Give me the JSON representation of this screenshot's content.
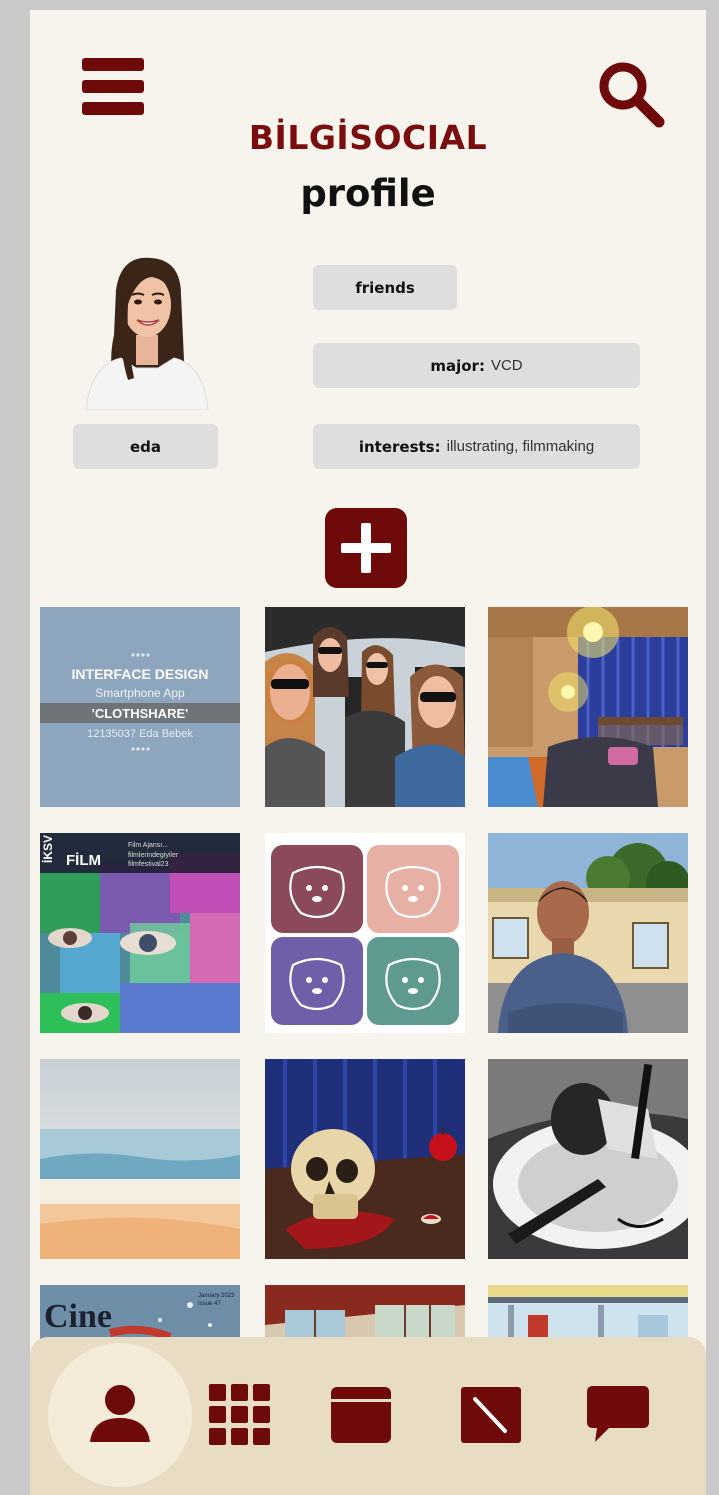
{
  "app": {
    "brand": "BİLGİSOCIAL",
    "page_title": "profile"
  },
  "profile": {
    "name": "eda",
    "friends_label": "friends",
    "major_label": "major:",
    "major_value": "VCD",
    "interests_label": "interests:",
    "interests_value": "illustrating, filmmaking"
  },
  "header": {
    "menu_icon": "hamburger-menu-icon",
    "search_icon": "search-icon"
  },
  "tiles": {
    "interface_design": {
      "line1": "INTERFACE DESIGN",
      "line2": "Smartphone App",
      "line3": "'CLOTHSHARE'",
      "line4": "12135037 Eda Bebek"
    },
    "iksv": {
      "logo": "İKSV",
      "film": "FİLM",
      "line1": "Film Ajansı...",
      "line2": "filmlerindegiyiler",
      "line3": "filmfestival23"
    },
    "cine": {
      "title": "Cine",
      "line1": "January 2023",
      "line2": "Issue 47"
    }
  },
  "bottom_nav": {
    "items": [
      "profile",
      "grid",
      "calendar",
      "notes",
      "messages"
    ],
    "active": "profile"
  },
  "colors": {
    "accent": "#6e0a0a",
    "background": "#f7f3ed",
    "pill": "#dedede",
    "nav_bar": "#e8dcc4"
  }
}
